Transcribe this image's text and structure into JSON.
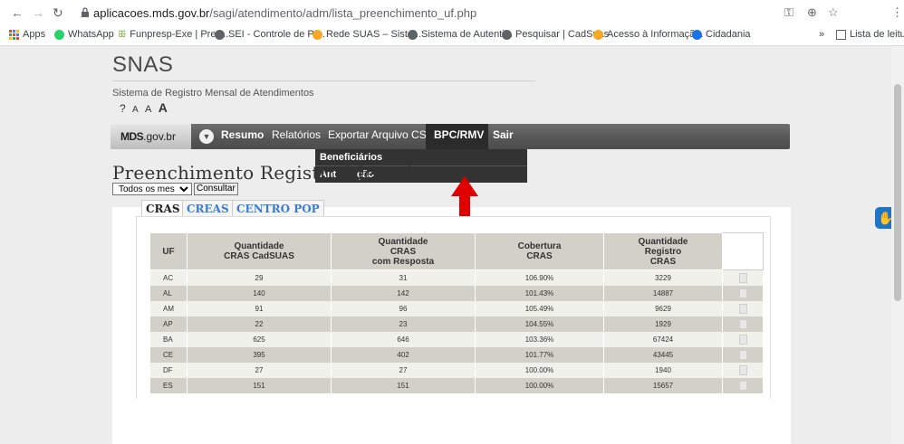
{
  "browser": {
    "url_host": "aplicacoes.mds.gov.br",
    "url_path": "/sagi/atendimento/adm/lista_preenchimento_uf.php",
    "bookmarks": [
      {
        "label": "Apps",
        "color": "#d93025"
      },
      {
        "label": "WhatsApp",
        "color": "#25d366"
      },
      {
        "label": "Funpresp-Exe | Prev...",
        "color": "#7cb342"
      },
      {
        "label": "SEI - Controle de Pr...",
        "color": "#5f6368"
      },
      {
        "label": "Rede SUAS – Siste...",
        "color": "#f9a825"
      },
      {
        "label": "Sistema de Autenti...",
        "color": "#5f6368"
      },
      {
        "label": "Pesquisar | CadSuas",
        "color": "#5f6368"
      },
      {
        "label": "Acesso à Informaçã...",
        "color": "#f9a825"
      },
      {
        "label": "Cidadania",
        "color": "#1a73e8"
      }
    ],
    "reading_list": "Lista de leitura",
    "more": "»"
  },
  "site": {
    "title": "SNAS",
    "subtitle": "Sistema de Registro Mensal de Atendimentos",
    "font_controls": "? A A A"
  },
  "nav": {
    "logo_bold": "MDS",
    "logo_rest": ".gov.br",
    "items": [
      "Resumo",
      "Relatórios",
      "Exportar Arquivo CSV",
      "BPC/RMV",
      "Sair"
    ],
    "dropdown": [
      "Beneficiários",
      "Ant",
      "ção"
    ]
  },
  "main": {
    "heading": "Preenchimento Registro Mensal",
    "filter_value": "Todos os meses",
    "consult_label": "Consultar"
  },
  "tabs": [
    "CRAS",
    "CREAS",
    "CENTRO POP"
  ],
  "table": {
    "headers": [
      [
        "UF"
      ],
      [
        "Quantidade",
        "CRAS CadSUAS"
      ],
      [
        "Quantidade",
        "CRAS",
        "com Resposta"
      ],
      [
        "Cobertura",
        "CRAS"
      ],
      [
        "Quantidade",
        "Registro",
        "CRAS"
      ]
    ],
    "rows": [
      [
        "AC",
        "29",
        "31",
        "106.90%",
        "3229"
      ],
      [
        "AL",
        "140",
        "142",
        "101.43%",
        "14887"
      ],
      [
        "AM",
        "91",
        "96",
        "105.49%",
        "9629"
      ],
      [
        "AP",
        "22",
        "23",
        "104.55%",
        "1929"
      ],
      [
        "BA",
        "625",
        "646",
        "103.36%",
        "67424"
      ],
      [
        "CE",
        "395",
        "402",
        "101.77%",
        "43445"
      ],
      [
        "DF",
        "27",
        "27",
        "100.00%",
        "1940"
      ],
      [
        "ES",
        "151",
        "151",
        "100.00%",
        "15657"
      ]
    ]
  },
  "colors": {
    "nav_bg": "#555555",
    "arrow": "#e00000",
    "tab_link": "#3a7bd5",
    "row_dark": "#d1d1c9",
    "row_light": "#f1f1eb"
  }
}
